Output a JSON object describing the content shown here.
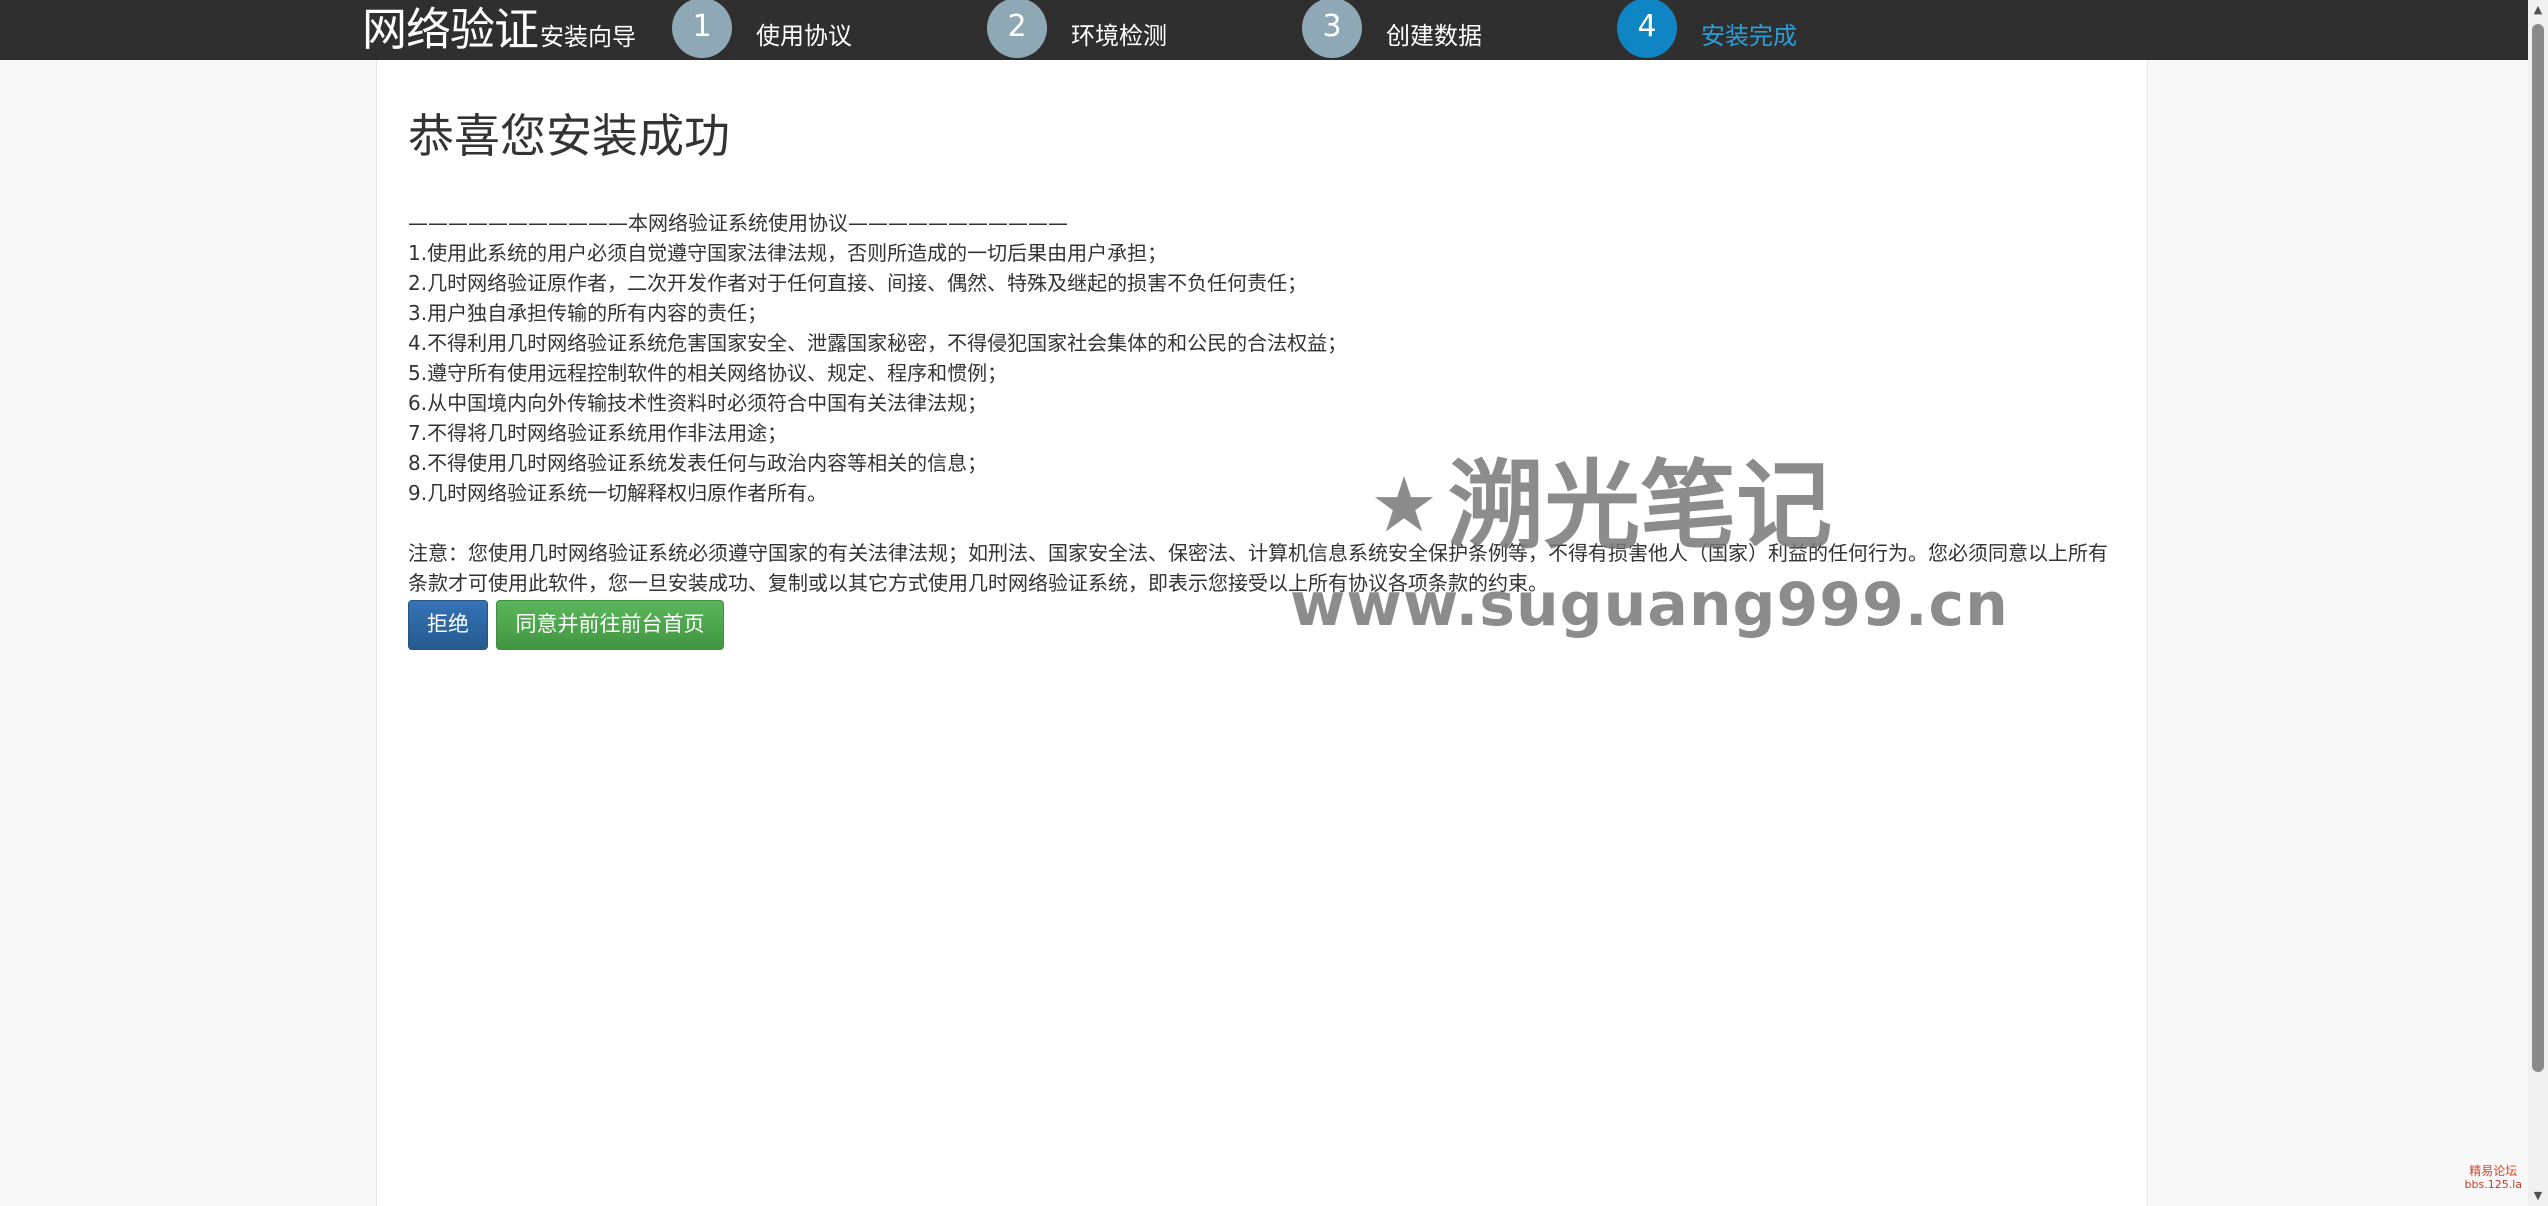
{
  "header": {
    "brand_main": "网络验证",
    "brand_sub": "安装向导",
    "steps": [
      {
        "number": "1",
        "label": "使用协议",
        "active": false
      },
      {
        "number": "2",
        "label": "环境检测",
        "active": false
      },
      {
        "number": "3",
        "label": "创建数据",
        "active": false
      },
      {
        "number": "4",
        "label": "安装完成",
        "active": true
      }
    ]
  },
  "main": {
    "title": "恭喜您安装成功",
    "agreement_header": "———————————本网络验证系统使用协议———————————",
    "agreement_items": [
      "1.使用此系统的用户必须自觉遵守国家法律法规，否则所造成的一切后果由用户承担；",
      "2.几时网络验证原作者，二次开发作者对于任何直接、间接、偶然、特殊及继起的损害不负任何责任；",
      "3.用户独自承担传输的所有内容的责任；",
      "4.不得利用几时网络验证系统危害国家安全、泄露国家秘密，不得侵犯国家社会集体的和公民的合法权益；",
      "5.遵守所有使用远程控制软件的相关网络协议、规定、程序和惯例；",
      "6.从中国境内向外传输技术性资料时必须符合中国有关法律法规；",
      "7.不得将几时网络验证系统用作非法用途；",
      "8.不得使用几时网络验证系统发表任何与政治内容等相关的信息；",
      "9.几时网络验证系统一切解释权归原作者所有。"
    ],
    "notice": "注意：您使用几时网络验证系统必须遵守国家的有关法律法规；如刑法、国家安全法、保密法、计算机信息系统安全保护条例等，不得有损害他人（国家）利益的任何行为。您必须同意以上所有条款才可使用此软件，您一旦安装成功、复制或以其它方式使用几时网络验证系统，即表示您接受以上所有协议各项条款的约束。",
    "buttons": {
      "refuse": "拒绝",
      "agree": "同意并前往前台首页"
    }
  },
  "watermark": {
    "star": "★",
    "title": "溯光笔记",
    "url": "www.suguang999.cn"
  },
  "corner_tag": {
    "line1": "精易论坛",
    "line2": "bbs.125.la"
  },
  "colors": {
    "header_bg": "#2f2f2f",
    "step_inactive": "#8fa8b5",
    "step_active": "#0f86c3",
    "refuse_button": "#2d6ca6",
    "agree_button": "#4cae4c"
  },
  "icons": {
    "scroll_up": "arrow-up-icon",
    "scroll_down": "arrow-down-icon"
  }
}
